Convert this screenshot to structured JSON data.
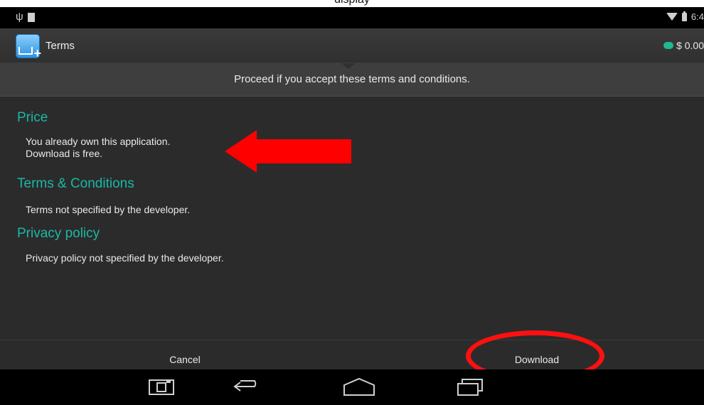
{
  "caption": "display",
  "status_bar": {
    "time": "6:4"
  },
  "action_bar": {
    "title": "Terms",
    "balance": "$ 0.00"
  },
  "header": {
    "message": "Proceed if you accept these terms and conditions."
  },
  "sections": [
    {
      "title": "Price",
      "lines": [
        "You already own this application.",
        "Download is free."
      ]
    },
    {
      "title": "Terms & Conditions",
      "lines": [
        "Terms not specified by the developer."
      ]
    },
    {
      "title": "Privacy policy",
      "lines": [
        "Privacy policy not specified by the developer."
      ]
    }
  ],
  "buttons": {
    "cancel": "Cancel",
    "download": "Download"
  },
  "annotations": {
    "arrow_color": "#ff0000",
    "oval_color": "#ff1010"
  },
  "nav_icons": [
    "screenshot-icon",
    "back-icon",
    "home-icon",
    "recents-icon"
  ]
}
